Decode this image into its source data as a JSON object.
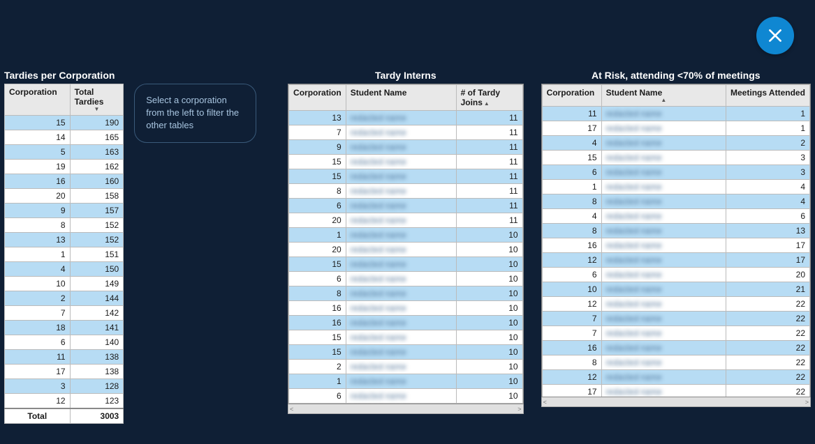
{
  "close_label": "Close",
  "instruction": "Select a corporation from the left to filter the other tables",
  "tables": {
    "left": {
      "title": "Tardies per Corporation",
      "headers": {
        "corp": "Corporation",
        "tt": "Total Tardies"
      },
      "sort_indicator": "▼",
      "rows": [
        {
          "corp": 15,
          "tt": 190
        },
        {
          "corp": 14,
          "tt": 165
        },
        {
          "corp": 5,
          "tt": 163
        },
        {
          "corp": 19,
          "tt": 162
        },
        {
          "corp": 16,
          "tt": 160
        },
        {
          "corp": 20,
          "tt": 158
        },
        {
          "corp": 9,
          "tt": 157
        },
        {
          "corp": 8,
          "tt": 152
        },
        {
          "corp": 13,
          "tt": 152
        },
        {
          "corp": 1,
          "tt": 151
        },
        {
          "corp": 4,
          "tt": 150
        },
        {
          "corp": 10,
          "tt": 149
        },
        {
          "corp": 2,
          "tt": 144
        },
        {
          "corp": 7,
          "tt": 142
        },
        {
          "corp": 18,
          "tt": 141
        },
        {
          "corp": 6,
          "tt": 140
        },
        {
          "corp": 11,
          "tt": 138
        },
        {
          "corp": 17,
          "tt": 138
        },
        {
          "corp": 3,
          "tt": 128
        },
        {
          "corp": 12,
          "tt": 123
        }
      ],
      "total": {
        "label": "Total",
        "value": 3003
      }
    },
    "mid": {
      "title": "Tardy Interns",
      "headers": {
        "corp": "Corporation",
        "name": "Student Name",
        "joins": "# of Tardy Joins"
      },
      "sort_indicator": "▲",
      "rows": [
        {
          "corp": 13,
          "joins": 11
        },
        {
          "corp": 7,
          "joins": 11
        },
        {
          "corp": 9,
          "joins": 11
        },
        {
          "corp": 15,
          "joins": 11
        },
        {
          "corp": 15,
          "joins": 11
        },
        {
          "corp": 8,
          "joins": 11
        },
        {
          "corp": 6,
          "joins": 11
        },
        {
          "corp": 20,
          "joins": 11
        },
        {
          "corp": 1,
          "joins": 10
        },
        {
          "corp": 20,
          "joins": 10
        },
        {
          "corp": 15,
          "joins": 10
        },
        {
          "corp": 6,
          "joins": 10
        },
        {
          "corp": 8,
          "joins": 10
        },
        {
          "corp": 16,
          "joins": 10
        },
        {
          "corp": 16,
          "joins": 10
        },
        {
          "corp": 15,
          "joins": 10
        },
        {
          "corp": 15,
          "joins": 10
        },
        {
          "corp": 2,
          "joins": 10
        },
        {
          "corp": 1,
          "joins": 10
        },
        {
          "corp": 6,
          "joins": 10
        }
      ]
    },
    "right": {
      "title": "At Risk, attending <70% of meetings",
      "headers": {
        "corp": "Corporation",
        "name": "Student Name",
        "meet": "Meetings Attended"
      },
      "sort_indicator": "▲",
      "rows": [
        {
          "corp": 11,
          "meet": 1
        },
        {
          "corp": 17,
          "meet": 1
        },
        {
          "corp": 4,
          "meet": 2
        },
        {
          "corp": 15,
          "meet": 3
        },
        {
          "corp": 6,
          "meet": 3
        },
        {
          "corp": 1,
          "meet": 4
        },
        {
          "corp": 8,
          "meet": 4
        },
        {
          "corp": 4,
          "meet": 6
        },
        {
          "corp": 8,
          "meet": 13
        },
        {
          "corp": 16,
          "meet": 17
        },
        {
          "corp": 12,
          "meet": 17
        },
        {
          "corp": 6,
          "meet": 20
        },
        {
          "corp": 10,
          "meet": 21
        },
        {
          "corp": 12,
          "meet": 22
        },
        {
          "corp": 7,
          "meet": 22
        },
        {
          "corp": 7,
          "meet": 22
        },
        {
          "corp": 16,
          "meet": 22
        },
        {
          "corp": 8,
          "meet": 22
        },
        {
          "corp": 12,
          "meet": 22
        },
        {
          "corp": 17,
          "meet": 22
        }
      ]
    }
  },
  "chart_data": [
    {
      "type": "table",
      "title": "Tardies per Corporation",
      "columns": [
        "Corporation",
        "Total Tardies"
      ],
      "rows": [
        [
          15,
          190
        ],
        [
          14,
          165
        ],
        [
          5,
          163
        ],
        [
          19,
          162
        ],
        [
          16,
          160
        ],
        [
          20,
          158
        ],
        [
          9,
          157
        ],
        [
          8,
          152
        ],
        [
          13,
          152
        ],
        [
          1,
          151
        ],
        [
          4,
          150
        ],
        [
          10,
          149
        ],
        [
          2,
          144
        ],
        [
          7,
          142
        ],
        [
          18,
          141
        ],
        [
          6,
          140
        ],
        [
          11,
          138
        ],
        [
          17,
          138
        ],
        [
          3,
          128
        ],
        [
          12,
          123
        ]
      ],
      "total_row": [
        "Total",
        3003
      ]
    },
    {
      "type": "table",
      "title": "Tardy Interns",
      "columns": [
        "Corporation",
        "Student Name",
        "# of Tardy Joins"
      ],
      "note": "Student Name column values are redacted/blurred in source",
      "rows": [
        [
          13,
          null,
          11
        ],
        [
          7,
          null,
          11
        ],
        [
          9,
          null,
          11
        ],
        [
          15,
          null,
          11
        ],
        [
          15,
          null,
          11
        ],
        [
          8,
          null,
          11
        ],
        [
          6,
          null,
          11
        ],
        [
          20,
          null,
          11
        ],
        [
          1,
          null,
          10
        ],
        [
          20,
          null,
          10
        ],
        [
          15,
          null,
          10
        ],
        [
          6,
          null,
          10
        ],
        [
          8,
          null,
          10
        ],
        [
          16,
          null,
          10
        ],
        [
          16,
          null,
          10
        ],
        [
          15,
          null,
          10
        ],
        [
          15,
          null,
          10
        ],
        [
          2,
          null,
          10
        ],
        [
          1,
          null,
          10
        ],
        [
          6,
          null,
          10
        ]
      ]
    },
    {
      "type": "table",
      "title": "At Risk, attending <70% of meetings",
      "columns": [
        "Corporation",
        "Student Name",
        "Meetings Attended"
      ],
      "note": "Student Name column values are redacted/blurred in source",
      "rows": [
        [
          11,
          null,
          1
        ],
        [
          17,
          null,
          1
        ],
        [
          4,
          null,
          2
        ],
        [
          15,
          null,
          3
        ],
        [
          6,
          null,
          3
        ],
        [
          1,
          null,
          4
        ],
        [
          8,
          null,
          4
        ],
        [
          4,
          null,
          6
        ],
        [
          8,
          null,
          13
        ],
        [
          16,
          null,
          17
        ],
        [
          12,
          null,
          17
        ],
        [
          6,
          null,
          20
        ],
        [
          10,
          null,
          21
        ],
        [
          12,
          null,
          22
        ],
        [
          7,
          null,
          22
        ],
        [
          7,
          null,
          22
        ],
        [
          16,
          null,
          22
        ],
        [
          8,
          null,
          22
        ],
        [
          12,
          null,
          22
        ],
        [
          17,
          null,
          22
        ]
      ]
    }
  ]
}
